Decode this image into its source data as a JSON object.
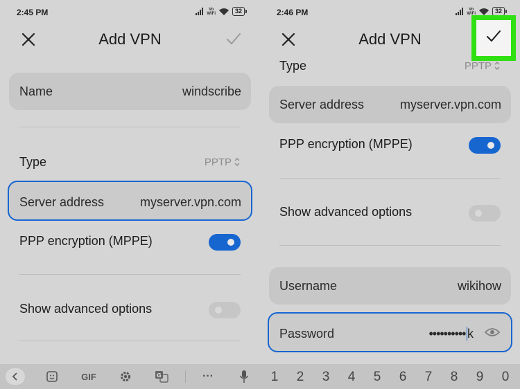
{
  "left": {
    "status": {
      "time": "2:45 PM",
      "vowifi_top": "Vo",
      "vowifi_bottom": "WiFi",
      "battery": "32"
    },
    "title": "Add VPN",
    "name": {
      "label": "Name",
      "value": "windscribe"
    },
    "type": {
      "label": "Type",
      "value": "PPTP"
    },
    "server": {
      "label": "Server address",
      "value": "myserver.vpn.com"
    },
    "ppp": {
      "label": "PPP encryption (MPPE)",
      "on": true
    },
    "advanced": {
      "label": "Show advanced options",
      "on": false
    }
  },
  "right": {
    "status": {
      "time": "2:46 PM",
      "vowifi_top": "Vo",
      "vowifi_bottom": "WiFi",
      "battery": "32"
    },
    "title": "Add VPN",
    "type": {
      "label": "Type",
      "value": "PPTP"
    },
    "server": {
      "label": "Server address",
      "value": "myserver.vpn.com"
    },
    "ppp": {
      "label": "PPP encryption (MPPE)",
      "on": true
    },
    "advanced": {
      "label": "Show advanced options",
      "on": false
    },
    "username": {
      "label": "Username",
      "value": "wikihow"
    },
    "password": {
      "label": "Password",
      "dots": "••••••••••",
      "typed": "k"
    }
  },
  "keyboard": {
    "gif_label": "GIF",
    "more_label": "···",
    "digits": [
      "1",
      "2",
      "3",
      "4",
      "5",
      "6",
      "7",
      "8",
      "9",
      "0"
    ]
  },
  "colors": {
    "accent": "#1766d0",
    "highlight": "#2fe012"
  }
}
